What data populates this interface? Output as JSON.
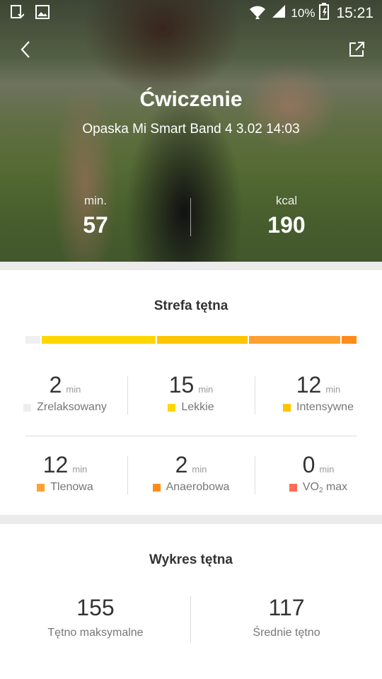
{
  "status_bar": {
    "battery_pct": "10%",
    "time": "15:21"
  },
  "header": {
    "title": "Ćwiczenie",
    "subtitle": "Opaska Mi Smart Band 4 3.02 14:03",
    "stats": [
      {
        "label": "min.",
        "value": "57"
      },
      {
        "label": "kcal",
        "value": "190"
      }
    ]
  },
  "hr_zone": {
    "title": "Strefa tętna",
    "bar_colors": [
      "#f0f0f0",
      "#ffd700",
      "#ffc400",
      "#ffa032",
      "#ff8c1a"
    ],
    "bar_shares": [
      2,
      15,
      12,
      12,
      2
    ],
    "unit": "min",
    "zones": [
      {
        "value": "2",
        "label": "Zrelaksowany",
        "color": "#eeeeee"
      },
      {
        "value": "15",
        "label": "Lekkie",
        "color": "#ffd700"
      },
      {
        "value": "12",
        "label": "Intensywne",
        "color": "#ffc400"
      },
      {
        "value": "12",
        "label": "Tlenowa",
        "color": "#ffa032"
      },
      {
        "value": "2",
        "label": "Anaerobowa",
        "color": "#ff8c1a"
      },
      {
        "value": "0",
        "label_main": "VO",
        "label_sub": "2",
        "label_tail": " max",
        "color": "#ff6b5a"
      }
    ]
  },
  "hr_chart": {
    "title": "Wykres tętna",
    "stats": [
      {
        "value": "155",
        "label": "Tętno maksymalne"
      },
      {
        "value": "117",
        "label": "Średnie tętno"
      }
    ]
  }
}
